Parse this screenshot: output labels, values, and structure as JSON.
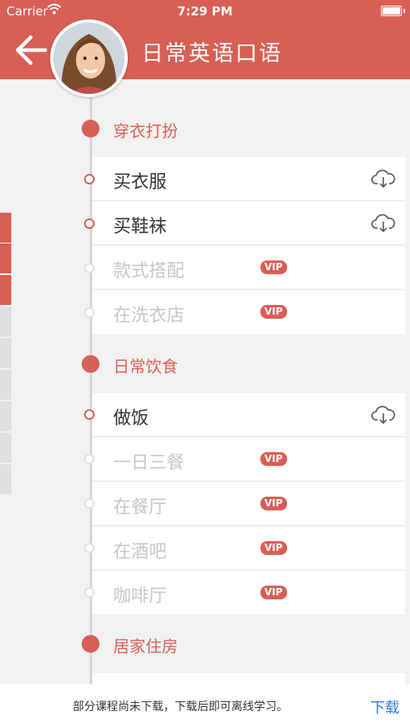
{
  "status": {
    "carrier": "Carrier",
    "time": "7:29 PM"
  },
  "header": {
    "title": "日常英语口语",
    "back_icon": "arrow-left-icon",
    "accent": "#d85f55"
  },
  "sections": [
    {
      "title": "穿衣打扮",
      "items": [
        {
          "label": "买衣服",
          "state": "downloadable"
        },
        {
          "label": "买鞋袜",
          "state": "downloadable"
        },
        {
          "label": "款式搭配",
          "state": "vip"
        },
        {
          "label": "在洗衣店",
          "state": "vip"
        }
      ]
    },
    {
      "title": "日常饮食",
      "items": [
        {
          "label": "做饭",
          "state": "downloadable"
        },
        {
          "label": "一日三餐",
          "state": "vip"
        },
        {
          "label": "在餐厅",
          "state": "vip"
        },
        {
          "label": "在酒吧",
          "state": "vip"
        },
        {
          "label": "咖啡厅",
          "state": "vip"
        }
      ]
    },
    {
      "title": "居家住房",
      "items": []
    }
  ],
  "badge": {
    "vip": "VIP"
  },
  "footer": {
    "message": "部分课程尚未下载，下载后即可离线学习。",
    "download": "下载",
    "link_color": "#2a7ce3"
  }
}
